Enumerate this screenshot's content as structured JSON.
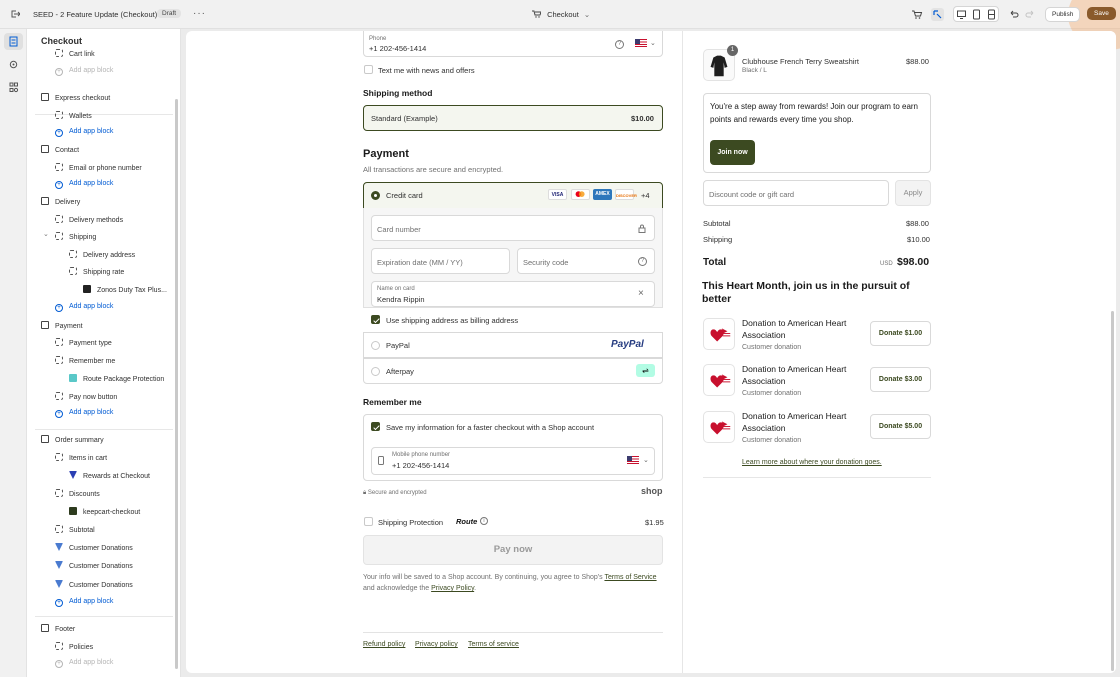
{
  "topbar": {
    "title": "SEED - 2 Feature Update (Checkout)",
    "status": "Draft",
    "page_select": "Checkout",
    "publish": "Publish",
    "save": "Save"
  },
  "sidebar": {
    "title": "Checkout",
    "items": [
      {
        "label": "Cart link",
        "kind": "item",
        "indent": 1
      },
      {
        "label": "Add app block",
        "kind": "add-muted",
        "indent": 1
      },
      {
        "label": "Express checkout",
        "kind": "section"
      },
      {
        "label": "Wallets",
        "kind": "item",
        "indent": 1
      },
      {
        "label": "Add app block",
        "kind": "add",
        "indent": 1
      },
      {
        "label": "Contact",
        "kind": "section"
      },
      {
        "label": "Email or phone number",
        "kind": "item",
        "indent": 1
      },
      {
        "label": "Add app block",
        "kind": "add",
        "indent": 1
      },
      {
        "label": "Delivery",
        "kind": "section"
      },
      {
        "label": "Delivery methods",
        "kind": "item",
        "indent": 1
      },
      {
        "label": "Shipping",
        "kind": "item",
        "indent": 1
      },
      {
        "label": "Delivery address",
        "kind": "item",
        "indent": 2
      },
      {
        "label": "Shipping rate",
        "kind": "item",
        "indent": 2
      },
      {
        "label": "Zonos Duty Tax Plus...",
        "kind": "app",
        "indent": 3
      },
      {
        "label": "Add app block",
        "kind": "add",
        "indent": 1
      },
      {
        "label": "Payment",
        "kind": "section"
      },
      {
        "label": "Payment type",
        "kind": "item",
        "indent": 1
      },
      {
        "label": "Remember me",
        "kind": "item",
        "indent": 1
      },
      {
        "label": "Route Package Protection",
        "kind": "app",
        "indent": 2
      },
      {
        "label": "Pay now button",
        "kind": "item",
        "indent": 1
      },
      {
        "label": "Add app block",
        "kind": "add",
        "indent": 1
      },
      {
        "label": "Order summary",
        "kind": "section"
      },
      {
        "label": "Items in cart",
        "kind": "item",
        "indent": 1
      },
      {
        "label": "Rewards at Checkout",
        "kind": "app",
        "indent": 2
      },
      {
        "label": "Discounts",
        "kind": "item",
        "indent": 1
      },
      {
        "label": "keepcart-checkout",
        "kind": "app",
        "indent": 2
      },
      {
        "label": "Subtotal",
        "kind": "item",
        "indent": 1
      },
      {
        "label": "Customer Donations",
        "kind": "app",
        "indent": 1
      },
      {
        "label": "Customer Donations",
        "kind": "app",
        "indent": 1
      },
      {
        "label": "Customer Donations",
        "kind": "app",
        "indent": 1
      },
      {
        "label": "Add app block",
        "kind": "add",
        "indent": 1
      },
      {
        "label": "Footer",
        "kind": "section"
      },
      {
        "label": "Policies",
        "kind": "item",
        "indent": 1
      },
      {
        "label": "Add app block",
        "kind": "add-muted",
        "indent": 1
      }
    ]
  },
  "checkout": {
    "phone_label": "Phone",
    "phone_value": "+1 202-456-1414",
    "news_offers": "Text me with news and offers",
    "shipping_method_heading": "Shipping method",
    "shipping_option": "Standard (Example)",
    "shipping_price": "$10.00",
    "payment_heading": "Payment",
    "payment_sub": "All transactions are secure and encrypted.",
    "credit_card": "Credit card",
    "more_cards": "+4",
    "card_number": "Card number",
    "expiration": "Expiration date (MM / YY)",
    "security_code": "Security code",
    "name_on_card_label": "Name on card",
    "name_on_card": "Kendra Rippin",
    "use_shipping_billing": "Use shipping address as billing address",
    "paypal": "PayPal",
    "paypal_logo": "PayPal",
    "afterpay": "Afterpay",
    "remember_heading": "Remember me",
    "save_info": "Save my information for a faster checkout with a Shop account",
    "mobile_label": "Mobile phone number",
    "mobile_value": "+1 202-456-1414",
    "secure": "Secure and encrypted",
    "shop_logo": "shop",
    "shipping_protection": "Shipping Protection",
    "route_logo": "Route",
    "protection_price": "$1.95",
    "pay_now": "Pay now",
    "legal_1": "Your info will be saved to a Shop account. By continuing, you agree to Shop's ",
    "terms_link": "Terms of Service",
    "legal_2": " and acknowledge the ",
    "privacy_link": "Privacy Policy",
    "legal_3": ".",
    "footer_links": [
      "Refund policy",
      "Privacy policy",
      "Terms of service"
    ]
  },
  "summary": {
    "item_qty": "1",
    "item_name": "Clubhouse French Terry Sweatshirt",
    "item_variant": "Black / L",
    "item_price": "$88.00",
    "rewards_text": "You're a step away from rewards! Join our program to earn points and rewards every time you shop.",
    "join_now": "Join now",
    "discount_placeholder": "Discount code or gift card",
    "apply": "Apply",
    "subtotal_label": "Subtotal",
    "subtotal": "$88.00",
    "shipping_label": "Shipping",
    "shipping": "$10.00",
    "total_label": "Total",
    "currency": "USD",
    "total": "$98.00",
    "heart_heading": "This Heart Month, join us in the pursuit of better",
    "donations": [
      {
        "title": "Donation to American Heart Association",
        "sub": "Customer donation",
        "button": "Donate $1.00"
      },
      {
        "title": "Donation to American Heart Association",
        "sub": "Customer donation",
        "button": "Donate $3.00"
      },
      {
        "title": "Donation to American Heart Association",
        "sub": "Customer donation",
        "button": "Donate $5.00"
      }
    ],
    "learn_more": "Learn more about where your donation goes."
  },
  "colors": {
    "accent": "#3c4a21",
    "save_button": "#8a5a2b",
    "link_blue": "#005bd3",
    "heart_red": "#c8102e"
  },
  "icons": [
    "exit-icon",
    "more-icon",
    "cart-icon",
    "inspector-icon",
    "desktop-icon",
    "tablet-icon",
    "mobile-icon",
    "undo-icon",
    "redo-icon",
    "sections-icon",
    "settings-icon",
    "apps-icon"
  ]
}
